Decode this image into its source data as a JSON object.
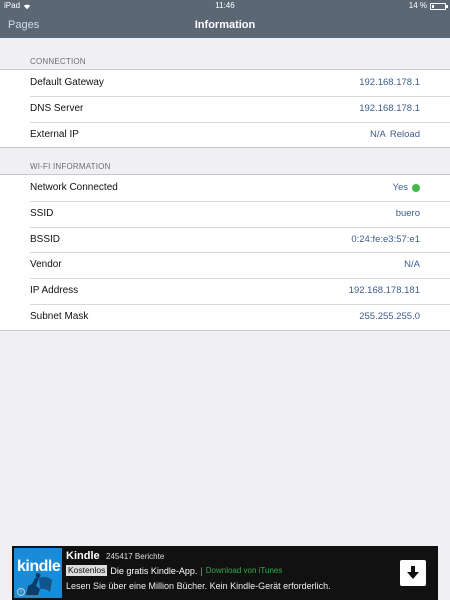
{
  "status_bar": {
    "device": "iPad",
    "time": "11:46",
    "battery": "14 %",
    "battery_level": 0.14
  },
  "nav": {
    "back_label": "Pages",
    "title": "Information"
  },
  "connection": {
    "header": "CONNECTION",
    "rows": [
      {
        "label": "Default Gateway",
        "value": "192.168.178.1"
      },
      {
        "label": "DNS Server",
        "value": "192.168.178.1"
      },
      {
        "label": "External IP",
        "value": "N/A",
        "action": "Reload"
      }
    ]
  },
  "wifi": {
    "header": "WI-FI INFORMATION",
    "rows": [
      {
        "label": "Network Connected",
        "value": "Yes",
        "status_color": "#43b94a"
      },
      {
        "label": "SSID",
        "value": "buero"
      },
      {
        "label": "BSSID",
        "value": "0:24:fe:e3:57:e1"
      },
      {
        "label": "Vendor",
        "value": "N/A"
      },
      {
        "label": "IP Address",
        "value": "192.168.178.181"
      },
      {
        "label": "Subnet Mask",
        "value": "255.255.255.0"
      }
    ]
  },
  "ad": {
    "logo_text": "kindle",
    "app_name": "Kindle",
    "reviews": "245417 Berichte",
    "badge": "Kostenlos",
    "tagline": "Die gratis Kindle-App.",
    "separator": "|",
    "itunes_link": "Download von iTunes",
    "itunes_color": "#39a84a",
    "description": "Lesen Sie über eine Million Bücher. Kein Kindle-Gerät erforderlich.",
    "info_glyph": "i"
  },
  "colors": {
    "nav_bar": "#5c6776",
    "value_text": "#3d5d8c",
    "background": "#efeff4"
  },
  "icons": [
    "wifi-icon",
    "battery-icon",
    "kindle-reader-icon",
    "info-icon",
    "download-arrow-icon"
  ]
}
